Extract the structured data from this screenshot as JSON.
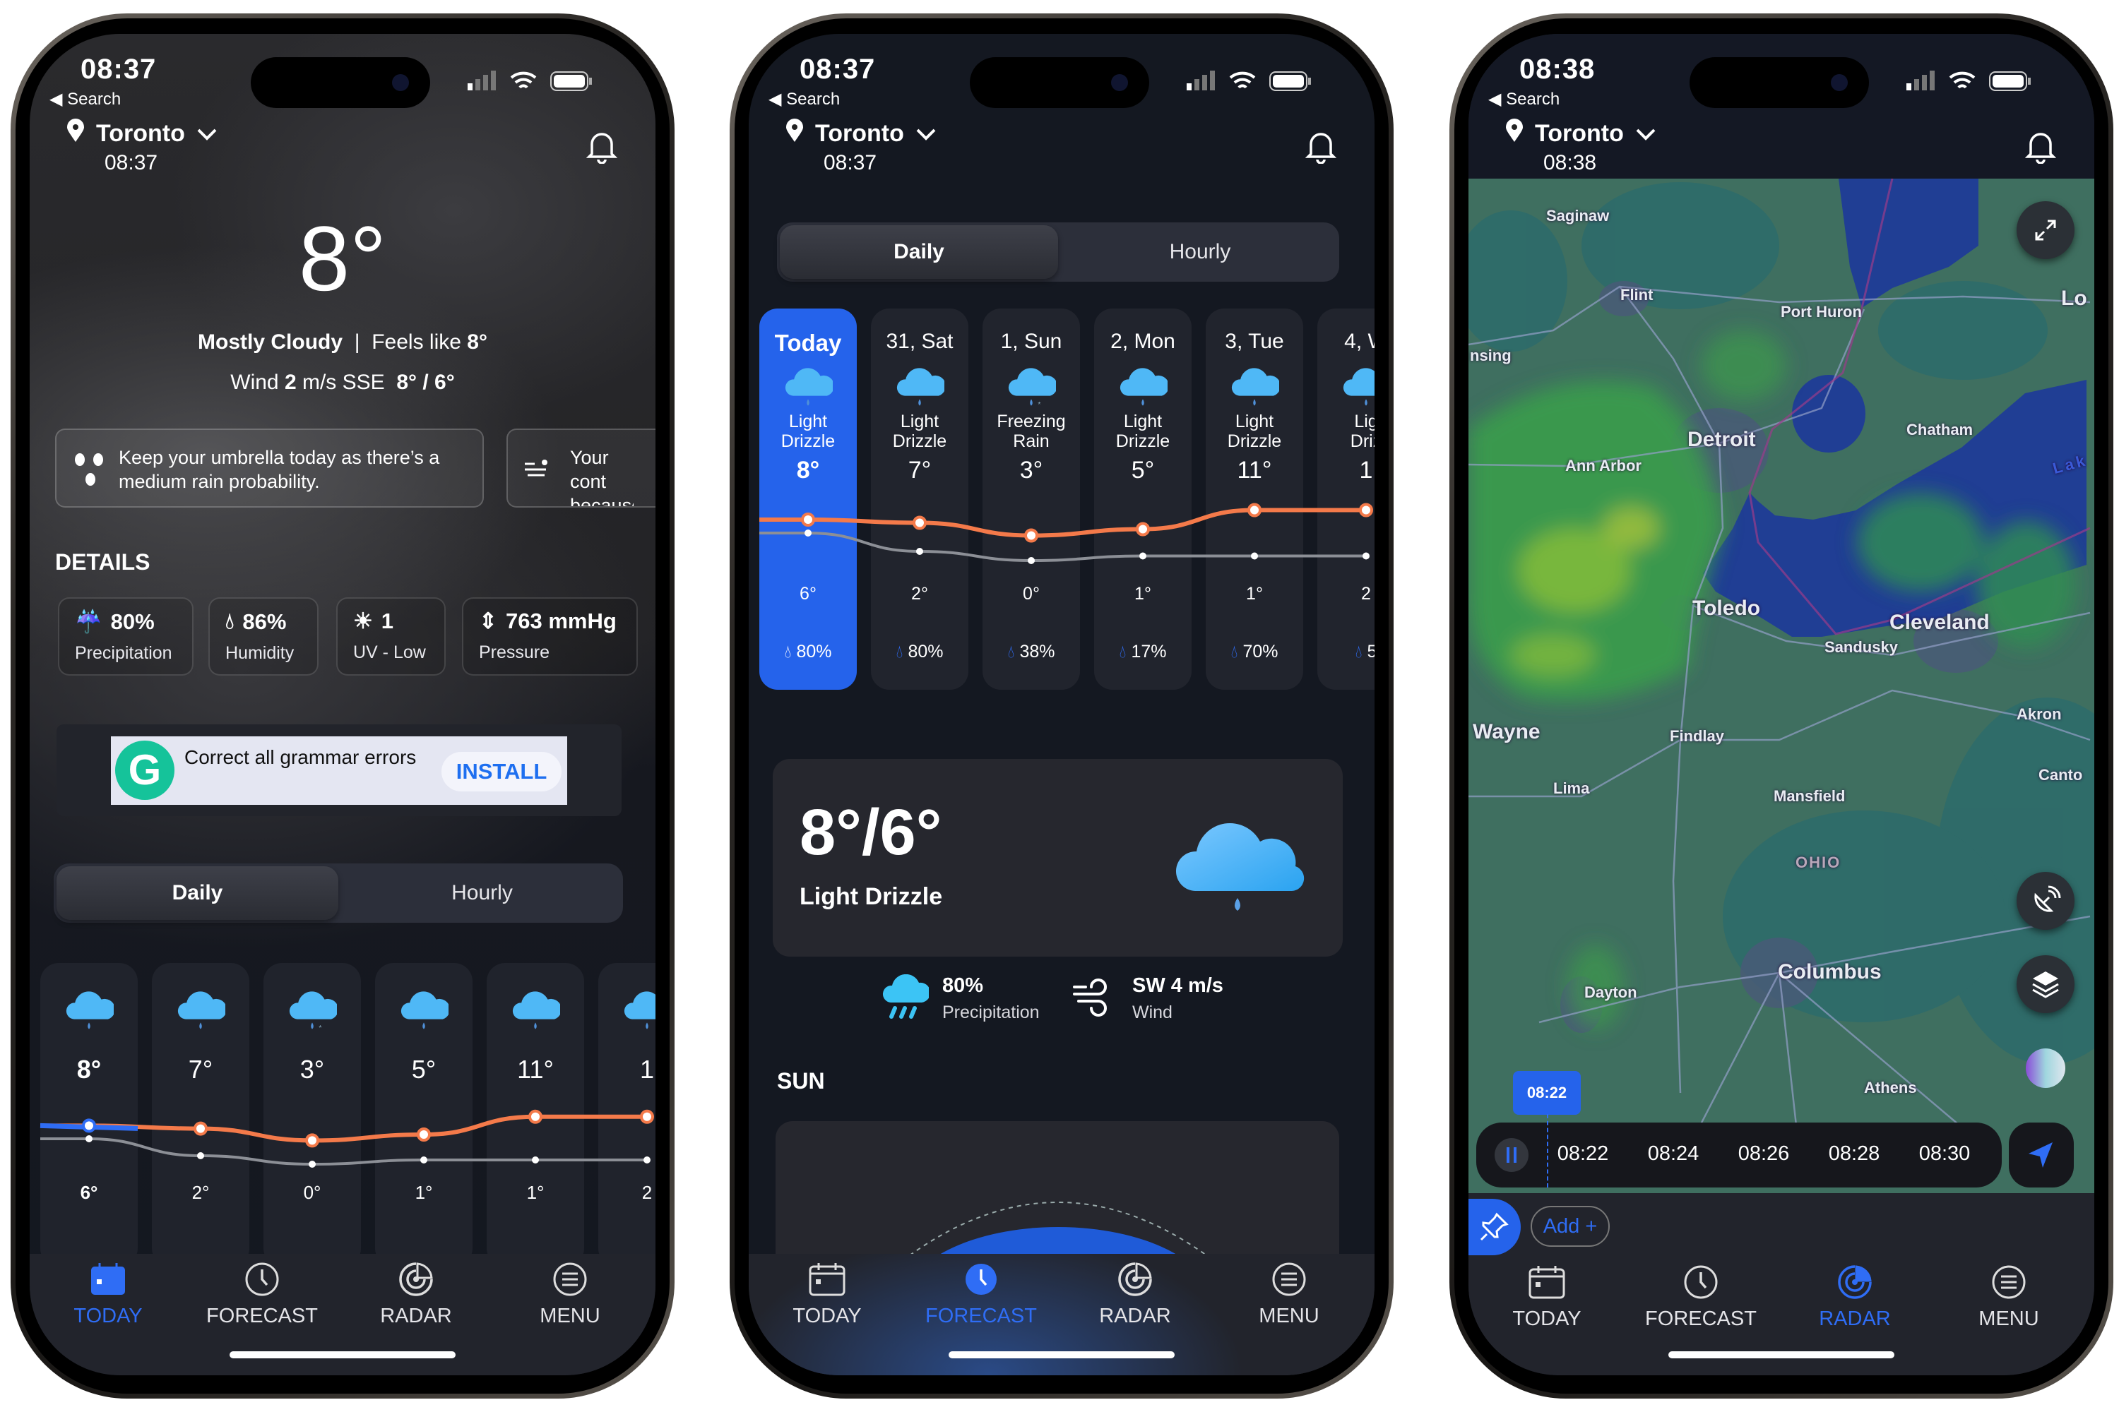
{
  "colors": {
    "accent": "#2f6df5",
    "high_line": "#f47a4a",
    "low_line": "#8c8f96",
    "today_card": "#2563eb"
  },
  "status": {
    "back_label": "◀ Search"
  },
  "phones": [
    {
      "status_time": "08:37",
      "location": {
        "city": "Toronto",
        "time": "08:37"
      },
      "current": {
        "temp": "8°",
        "condition": "Mostly Cloudy",
        "separator": "|",
        "feels_label": "Feels like",
        "feels_value": "8°",
        "wind_label": "Wind",
        "wind_speed": "2",
        "wind_unit": "m/s SSE",
        "hi_lo": "8° / 6°"
      },
      "tips": [
        {
          "icon": "rain-drops-icon",
          "text": "Keep your umbrella today as there’s a medium rain probability."
        },
        {
          "icon": "wind-icon",
          "text": "Your cont because"
        }
      ],
      "details_title": "DETAILS",
      "details": [
        {
          "icon": "precipitation-icon",
          "value": "80%",
          "label": "Precipitation"
        },
        {
          "icon": "humidity-icon",
          "value": "86%",
          "label": "Humidity"
        },
        {
          "icon": "uv-icon",
          "value": "1",
          "label": "UV - Low"
        },
        {
          "icon": "pressure-icon",
          "value": "763 mmHg",
          "label": "Pressure"
        }
      ],
      "ad": {
        "text": "Correct all grammar errors",
        "button": "INSTALL",
        "logo_letter": "G"
      },
      "segment": {
        "daily": "Daily",
        "hourly": "Hourly",
        "selected": "Daily"
      },
      "days": [
        {
          "high": "8°",
          "low": "6°",
          "hi": 8,
          "lo": 6
        },
        {
          "high": "7°",
          "low": "2°",
          "hi": 7,
          "lo": 2
        },
        {
          "high": "3°",
          "low": "0°",
          "hi": 3,
          "lo": 0
        },
        {
          "high": "5°",
          "low": "1°",
          "hi": 5,
          "lo": 1
        },
        {
          "high": "11°",
          "low": "1°",
          "hi": 11,
          "lo": 1
        },
        {
          "high": "1",
          "low": "2",
          "hi": 11,
          "lo": 1
        }
      ],
      "active_tab": "TODAY"
    },
    {
      "status_time": "08:37",
      "location": {
        "city": "Toronto",
        "time": "08:37"
      },
      "segment": {
        "daily": "Daily",
        "hourly": "Hourly",
        "selected": "Daily"
      },
      "days": [
        {
          "date": "Today",
          "cond1": "Light",
          "cond2": "Drizzle",
          "high": "8°",
          "low": "6°",
          "precip": "80%",
          "hi": 8,
          "lo": 6
        },
        {
          "date": "31, Sat",
          "cond1": "Light",
          "cond2": "Drizzle",
          "high": "7°",
          "low": "2°",
          "precip": "80%",
          "hi": 7,
          "lo": 2
        },
        {
          "date": "1, Sun",
          "cond1": "Freezing",
          "cond2": "Rain",
          "high": "3°",
          "low": "0°",
          "precip": "38%",
          "hi": 3,
          "lo": 0
        },
        {
          "date": "2, Mon",
          "cond1": "Light",
          "cond2": "Drizzle",
          "high": "5°",
          "low": "1°",
          "precip": "17%",
          "hi": 5,
          "lo": 1
        },
        {
          "date": "3, Tue",
          "cond1": "Light",
          "cond2": "Drizzle",
          "high": "11°",
          "low": "1°",
          "precip": "70%",
          "hi": 11,
          "lo": 1
        },
        {
          "date": "4, W",
          "cond1": "Lig",
          "cond2": "Driz",
          "high": "1",
          "low": "2",
          "precip": "5",
          "hi": 11,
          "lo": 1
        }
      ],
      "summary": {
        "temps": "8°/6°",
        "condition": "Light Drizzle",
        "precip_value": "80%",
        "precip_label": "Precipitation",
        "wind_value": "SW 4 m/s",
        "wind_label": "Wind"
      },
      "sun_title": "SUN",
      "active_tab": "FORECAST"
    },
    {
      "status_time": "08:38",
      "location": {
        "city": "Toronto",
        "time": "08:38"
      },
      "map_labels": {
        "saginaw": "Saginaw",
        "flint": "Flint",
        "port_huron": "Port Huron",
        "london": "Lo",
        "lansing": "nsing",
        "detroit": "Detroit",
        "chatham": "Chatham",
        "ann_arbor": "Ann Arbor",
        "lake": "Lak",
        "toledo": "Toledo",
        "cleveland": "Cleveland",
        "sandusky": "Sandusky",
        "wayne": "Wayne",
        "findlay": "Findlay",
        "akron": "Akron",
        "canton": "Canto",
        "lima": "Lima",
        "mansfield": "Mansfield",
        "ohio": "OHIO",
        "columbus": "Columbus",
        "dayton": "Dayton",
        "athens": "Athens"
      },
      "timeline": {
        "current": "08:22",
        "times": [
          "08:22",
          "08:24",
          "08:26",
          "08:28",
          "08:30"
        ],
        "playing": true
      },
      "add_label": "Add +",
      "active_tab": "RADAR"
    }
  ],
  "tabs": [
    {
      "label": "TODAY",
      "icon": "calendar-icon"
    },
    {
      "label": "FORECAST",
      "icon": "clock-icon"
    },
    {
      "label": "RADAR",
      "icon": "radar-icon"
    },
    {
      "label": "MENU",
      "icon": "menu-icon"
    }
  ]
}
